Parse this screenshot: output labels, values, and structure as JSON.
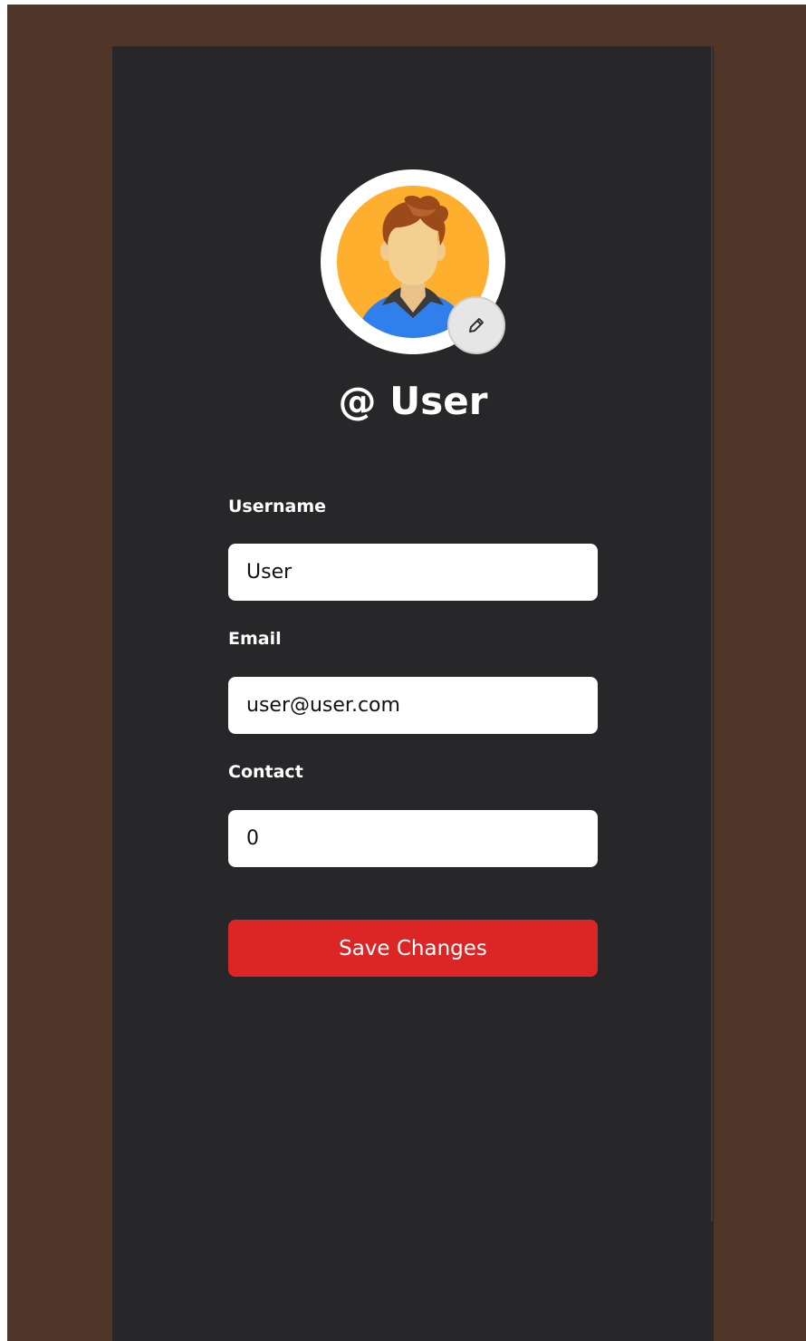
{
  "profile": {
    "title": "@ User",
    "avatar_icon": "user-avatar-illustration",
    "edit_icon": "pencil-icon"
  },
  "form": {
    "username_label": "Username",
    "username_value": "User",
    "email_label": "Email",
    "email_value": "user@user.com",
    "contact_label": "Contact",
    "contact_value": "0",
    "save_label": "Save Changes"
  },
  "colors": {
    "frame_background": "#4f3629",
    "panel_background": "#272628",
    "avatar_background": "#ffaf2e",
    "save_button": "#dc2626"
  }
}
